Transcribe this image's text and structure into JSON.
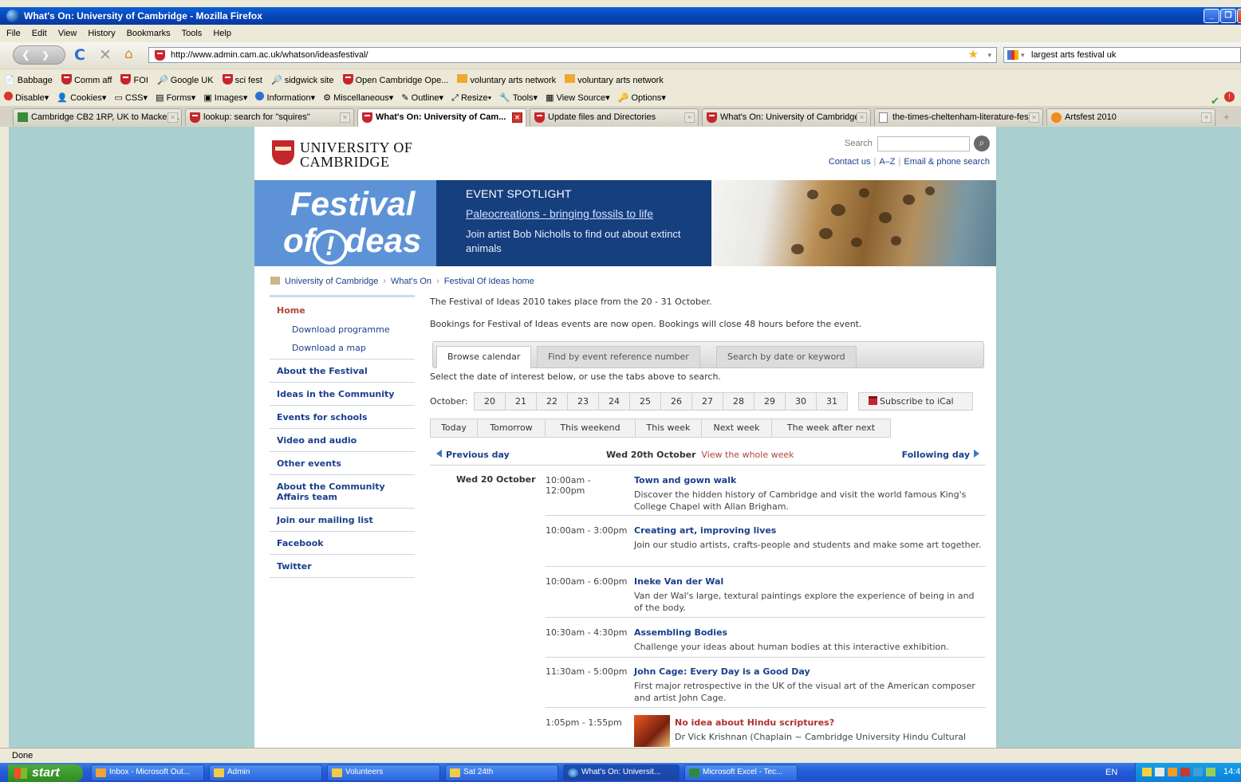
{
  "window": {
    "title": "What's On: University of Cambridge - Mozilla Firefox"
  },
  "menu": [
    "File",
    "Edit",
    "View",
    "History",
    "Bookmarks",
    "Tools",
    "Help"
  ],
  "address": {
    "url": "http://www.admin.cam.ac.uk/whatson/ideasfestival/"
  },
  "websearch": {
    "value": "largest arts festival uk"
  },
  "bookmarks": [
    "Babbage",
    "Comm aff",
    "FOI",
    "Google UK",
    "sci fest",
    "sidgwick site",
    "Open Cambridge Ope...",
    "voluntary arts network",
    "voluntary arts network"
  ],
  "devbar": [
    "Disable",
    "Cookies",
    "CSS",
    "Forms",
    "Images",
    "Information",
    "Miscellaneous",
    "Outline",
    "Resize",
    "Tools",
    "View Source",
    "Options"
  ],
  "tabs": [
    "Cambridge CB2 1RP, UK to Macken...",
    "lookup: search for \"squires\"",
    "What's On: University of Cam...",
    "Update files and Directories",
    "What's On: University of Cambridge",
    "the-times-cheltenham-literature-fes...",
    "Artsfest 2010"
  ],
  "page": {
    "logo": {
      "line1": "UNIVERSITY OF",
      "line2": "CAMBRIDGE"
    },
    "search_label": "Search",
    "top_links": [
      "Contact us",
      "A–Z",
      "Email & phone search"
    ],
    "festival_logo": {
      "line1": "Festival",
      "line2_pre": "of",
      "line2_bang": "!",
      "line2_post": "deas"
    },
    "spotlight": {
      "heading": "EVENT SPOTLIGHT",
      "link": "Paleocreations - bringing fossils to life",
      "desc": "Join artist Bob Nicholls to find out about extinct animals"
    },
    "breadcrumb": [
      "University of Cambridge",
      "What's On",
      "Festival Of Ideas home"
    ],
    "nav": {
      "home": "Home",
      "subs": [
        "Download programme",
        "Download a map"
      ],
      "items": [
        "About the Festival",
        "Ideas in the Community",
        "Events for schools",
        "Video and audio",
        "Other events",
        "About the Community Affairs team",
        "Join our mailing list",
        "Facebook",
        "Twitter"
      ]
    },
    "intro1": "The Festival of Ideas 2010 takes place from the 20 - 31 October.",
    "intro2": "Bookings for Festival of Ideas events are now open. Bookings will close 48 hours before the event.",
    "search_tabs": [
      "Browse calendar",
      "Find by event reference number",
      "Search by date or keyword"
    ],
    "select_help": "Select the date of interest below, or use the tabs above to search.",
    "october_label": "October:",
    "days": [
      "20",
      "21",
      "22",
      "23",
      "24",
      "25",
      "26",
      "27",
      "28",
      "29",
      "30",
      "31"
    ],
    "ical": "Subscribe to iCal",
    "ranges": [
      "Today",
      "Tomorrow",
      "This weekend",
      "This week",
      "Next week",
      "The week after next"
    ],
    "day_nav": {
      "prev": "Previous day",
      "current": "Wed 20th October",
      "whole_week": "View the whole week",
      "next": "Following day"
    },
    "date_heading": "Wed 20 October",
    "events": [
      {
        "time": "10:00am - 12:00pm",
        "title": "Town and gown walk",
        "desc": "Discover the hidden history of Cambridge and visit the world famous King's College Chapel with Allan Brigham."
      },
      {
        "time": "10:00am - 3:00pm",
        "title": "Creating art, improving lives",
        "desc": "Join our studio artists, crafts-people and students and make some art together."
      },
      {
        "time": "10:00am - 6:00pm",
        "title": "Ineke Van der Wal",
        "desc": "Van der Wal's large, textural paintings explore the experience of being in and of the body."
      },
      {
        "time": "10:30am - 4:30pm",
        "title": "Assembling Bodies",
        "desc": "Challenge your ideas about human bodies at this interactive exhibition."
      },
      {
        "time": "11:30am - 5:00pm",
        "title": "John Cage: Every Day is a Good Day",
        "desc": "First major retrospective in the UK of the visual art of the American composer and artist John Cage."
      },
      {
        "time": "1:05pm - 1:55pm",
        "title": "No idea about Hindu scriptures?",
        "desc": "Dr Vick Krishnan (Chaplain ~ Cambridge University Hindu Cultural"
      }
    ]
  },
  "status": "Done",
  "taskbar": {
    "start": "start",
    "items": [
      "Inbox - Microsoft Out...",
      "Admin",
      "Volunteers",
      "Sat 24th",
      "What's On: Universit...",
      "Microsoft Excel - Tec..."
    ],
    "lang": "EN",
    "clock": "14:4"
  }
}
